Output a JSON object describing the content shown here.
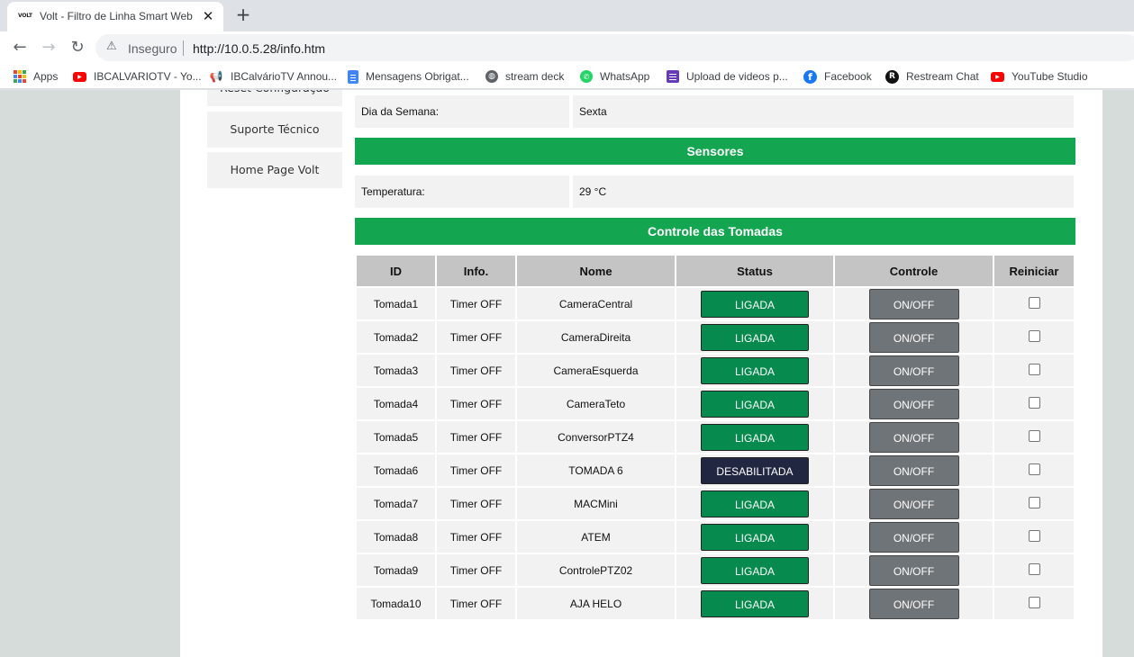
{
  "browser": {
    "tab_title": "Volt - Filtro de Linha Smart Web",
    "tab_favicon_text": "VOLT",
    "tab_close_glyph": "✕",
    "new_tab_glyph": "+",
    "security_label": "Inseguro",
    "url": "http://10.0.5.28/info.htm",
    "bookmarks": [
      {
        "label": "Apps",
        "icon": "apps-grid-icon"
      },
      {
        "label": "IBCALVARIOTV - Yo...",
        "icon": "youtube-icon"
      },
      {
        "label": "IBCalvárioTV Annou...",
        "icon": "megaphone-icon"
      },
      {
        "label": "Mensagens Obrigat...",
        "icon": "google-docs-icon"
      },
      {
        "label": "stream deck",
        "icon": "globe-icon"
      },
      {
        "label": "WhatsApp",
        "icon": "whatsapp-icon"
      },
      {
        "label": "Upload de videos p...",
        "icon": "google-forms-icon"
      },
      {
        "label": "Facebook",
        "icon": "facebook-icon"
      },
      {
        "label": "Restream Chat",
        "icon": "restream-icon"
      },
      {
        "label": "YouTube Studio",
        "icon": "youtube-icon"
      }
    ]
  },
  "sidebar": {
    "items": [
      "Reset Configuração",
      "Suporte Técnico",
      "Home Page Volt"
    ]
  },
  "info": {
    "weekday_label": "Dia da Semana:",
    "weekday_value": "Sexta",
    "sensors_header": "Sensores",
    "temperature_label": "Temperatura:",
    "temperature_value": "29 °C"
  },
  "outlets": {
    "header": "Controle das Tomadas",
    "columns": [
      "ID",
      "Info.",
      "Nome",
      "Status",
      "Controle",
      "Reiniciar"
    ],
    "control_label": "ON/OFF",
    "rows": [
      {
        "id": "Tomada1",
        "info": "Timer OFF",
        "name": "CameraCentral",
        "status": "LIGADA"
      },
      {
        "id": "Tomada2",
        "info": "Timer OFF",
        "name": "CameraDireita",
        "status": "LIGADA"
      },
      {
        "id": "Tomada3",
        "info": "Timer OFF",
        "name": "CameraEsquerda",
        "status": "LIGADA"
      },
      {
        "id": "Tomada4",
        "info": "Timer OFF",
        "name": "CameraTeto",
        "status": "LIGADA"
      },
      {
        "id": "Tomada5",
        "info": "Timer OFF",
        "name": "ConversorPTZ4",
        "status": "LIGADA"
      },
      {
        "id": "Tomada6",
        "info": "Timer OFF",
        "name": "TOMADA 6",
        "status": "DESABILITADA"
      },
      {
        "id": "Tomada7",
        "info": "Timer OFF",
        "name": "MACMini",
        "status": "LIGADA"
      },
      {
        "id": "Tomada8",
        "info": "Timer OFF",
        "name": "ATEM",
        "status": "LIGADA"
      },
      {
        "id": "Tomada9",
        "info": "Timer OFF",
        "name": "ControlePTZ02",
        "status": "LIGADA"
      },
      {
        "id": "Tomada10",
        "info": "Timer OFF",
        "name": "AJA HELO",
        "status": "LIGADA"
      }
    ]
  },
  "colors": {
    "section_header": "#14a550",
    "status_on": "#078a4e",
    "status_disabled": "#222741",
    "control_button": "#6f7478"
  }
}
